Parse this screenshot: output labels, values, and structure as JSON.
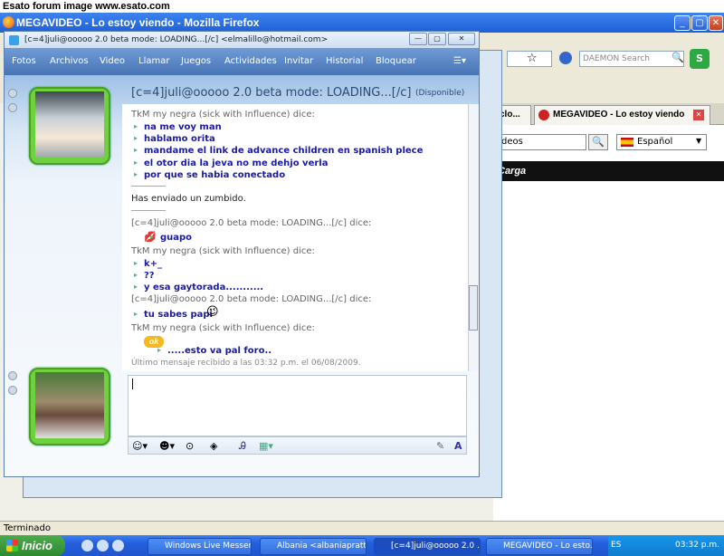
{
  "banner": {
    "text": "Esato forum image www.esato.com"
  },
  "firefox": {
    "title": "MEGAVIDEO - Lo estoy viendo - Mozilla Firefox",
    "search_placeholder": "DAEMON Search",
    "tabs": [
      {
        "label": "clo..."
      },
      {
        "label": "MEGAVIDEO - Lo estoy viendo"
      }
    ],
    "status": "Terminado"
  },
  "megavideo": {
    "search_text": "deos",
    "language": "Español",
    "bar_text": "Carga"
  },
  "msn": {
    "window_title": "[c=4]juli@ooooo 2.0 beta mode: LOADING...[/c] <elmalillo@hotmail.com>",
    "menu": [
      "Fotos",
      "Archivos",
      "Video",
      "Llamar",
      "Juegos",
      "Actividades",
      "Invitar",
      "Historial",
      "Bloquear"
    ],
    "conversation_title": "[c=4]juli@ooooo 2.0 beta mode: LOADING...[/c]",
    "contact_status": "(Disponible)",
    "transcript": [
      {
        "type": "speaker",
        "text": "TkM my negra (sick with Influence) dice:"
      },
      {
        "type": "msg",
        "text": "na me voy man"
      },
      {
        "type": "msg",
        "text": "hablamo orita"
      },
      {
        "type": "msg",
        "text": "mandame el link de advance children en spanish plece"
      },
      {
        "type": "msg",
        "text": "el otor dia la jeva no me dehjo verla"
      },
      {
        "type": "msg",
        "text": "por que se habia conectado"
      },
      {
        "type": "sys",
        "text": "Has enviado un zumbido."
      },
      {
        "type": "speaker",
        "text": "[c=4]juli@ooooo 2.0 beta mode: LOADING...[/c] dice:"
      },
      {
        "type": "msg",
        "text": "guapo"
      },
      {
        "type": "speaker",
        "text": "TkM my negra (sick with Influence) dice:"
      },
      {
        "type": "msg",
        "text": "k+_"
      },
      {
        "type": "msg",
        "text": "??"
      },
      {
        "type": "msg",
        "text": "y esa gaytorada..........."
      },
      {
        "type": "speaker",
        "text": "[c=4]juli@ooooo 2.0 beta mode: LOADING...[/c] dice:"
      },
      {
        "type": "msg",
        "text": "tu sabes papi"
      },
      {
        "type": "speaker",
        "text": "TkM my negra (sick with Influence) dice:"
      },
      {
        "type": "msg",
        "text": ".....esto va pal foro.."
      }
    ],
    "last_message": "Último mensaje recibido a las 03:32 p.m. el 06/08/2009."
  },
  "taskbar": {
    "start": "Inicio",
    "tasks": [
      {
        "label": "Windows Live Messen..."
      },
      {
        "label": "Albania <albaniapratt..."
      },
      {
        "label": "[c=4]juli@ooooo 2.0 ..."
      },
      {
        "label": "MEGAVIDEO - Lo esto..."
      }
    ],
    "lang": "ES",
    "clock": "03:32 p.m."
  },
  "colors": {
    "msg_text": "#1a1aa6",
    "menubar": "#4874b6",
    "avatar_frame": "#6fd140",
    "taskbar": "#245edb",
    "start": "#2f8a2f"
  }
}
